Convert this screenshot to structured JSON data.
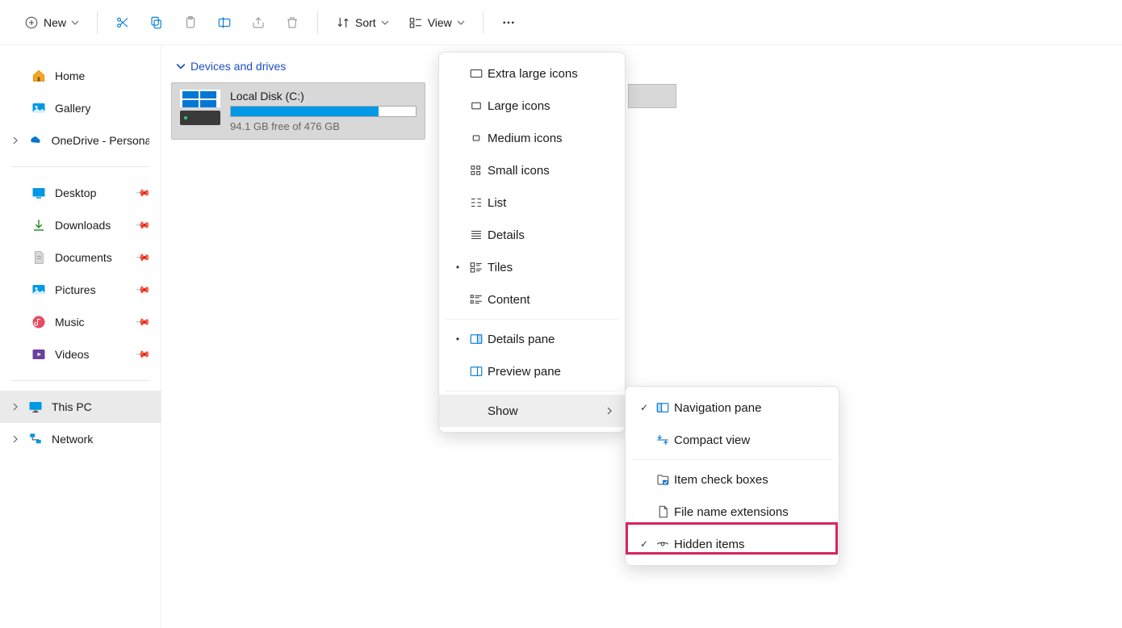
{
  "toolbar": {
    "new_label": "New",
    "sort_label": "Sort",
    "view_label": "View"
  },
  "sidebar": {
    "home": "Home",
    "gallery": "Gallery",
    "onedrive": "OneDrive - Persona",
    "desktop": "Desktop",
    "downloads": "Downloads",
    "documents": "Documents",
    "pictures": "Pictures",
    "music": "Music",
    "videos": "Videos",
    "this_pc": "This PC",
    "network": "Network"
  },
  "main": {
    "section_header": "Devices and drives",
    "drive": {
      "name": "Local Disk (C:)",
      "free_text": "94.1 GB free of 476 GB",
      "fill_percent": 80
    }
  },
  "view_menu": {
    "extra_large": "Extra large icons",
    "large": "Large icons",
    "medium": "Medium icons",
    "small": "Small icons",
    "list": "List",
    "details": "Details",
    "tiles": "Tiles",
    "content": "Content",
    "details_pane": "Details pane",
    "preview_pane": "Preview pane",
    "show": "Show"
  },
  "show_menu": {
    "navigation_pane": "Navigation pane",
    "compact_view": "Compact view",
    "item_check_boxes": "Item check boxes",
    "file_name_extensions": "File name extensions",
    "hidden_items": "Hidden items"
  }
}
